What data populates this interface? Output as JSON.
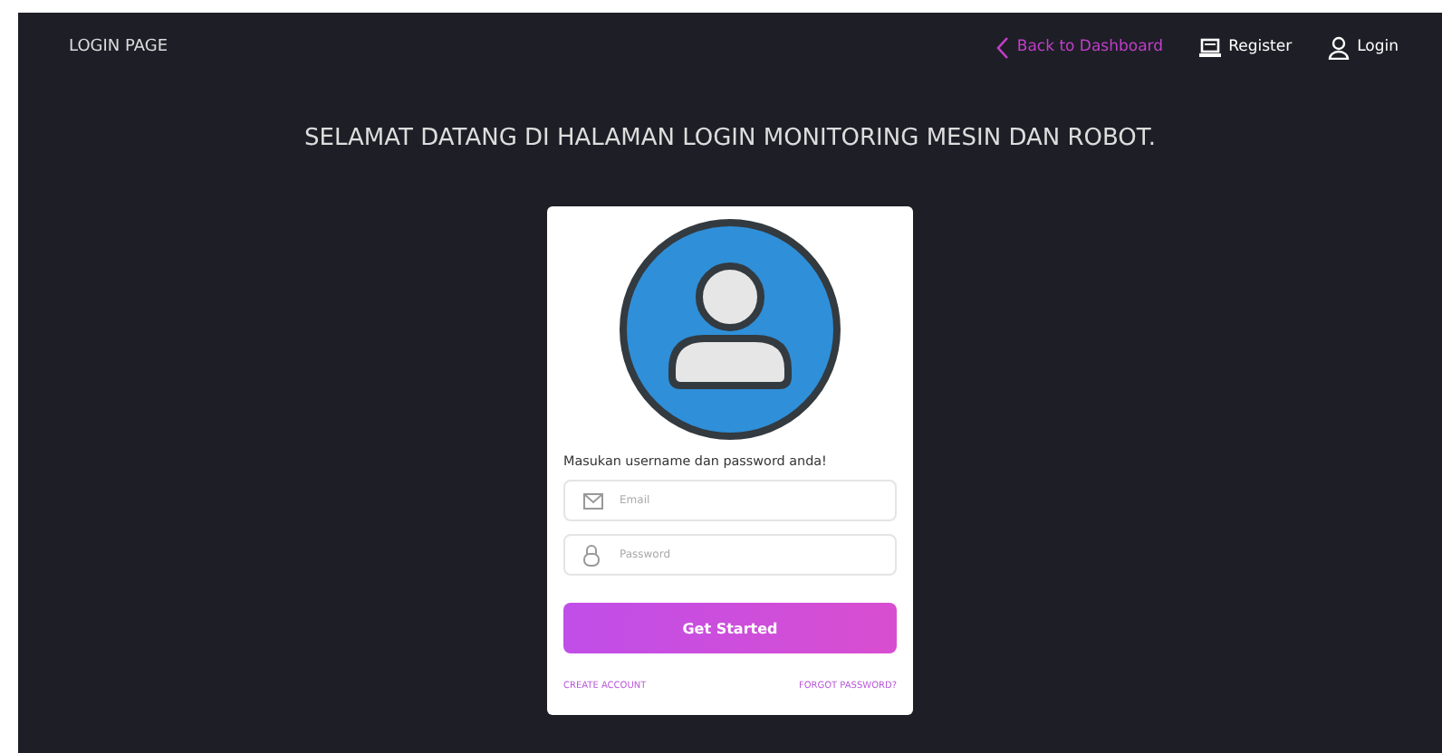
{
  "navbar": {
    "brand": "LOGIN PAGE",
    "links": [
      {
        "kind": "back",
        "label": "Back to Dashboard"
      },
      {
        "kind": "register",
        "label": "Register"
      },
      {
        "kind": "login",
        "label": "Login"
      }
    ]
  },
  "heading": "SELAMAT DATANG DI HALAMAN LOGIN MONITORING MESIN DAN ROBOT.",
  "card": {
    "prompt": "Masukan username dan password anda!",
    "fields": [
      {
        "kind": "email",
        "placeholder": "Email"
      },
      {
        "kind": "password",
        "placeholder": "Password"
      }
    ],
    "button": "Get Started",
    "links": [
      "CREATE ACCOUNT",
      "FORGOT PASSWORD?"
    ]
  }
}
